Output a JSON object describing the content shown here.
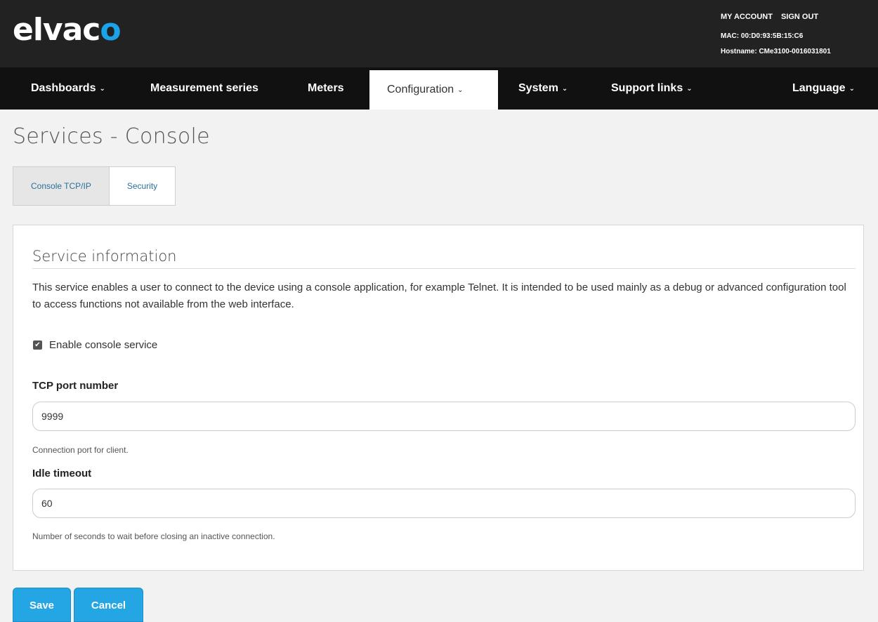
{
  "header": {
    "logo_main": "elvac",
    "logo_accent": "o",
    "my_account": "MY ACCOUNT",
    "sign_out": "SIGN OUT",
    "mac": "MAC: 00:D0:93:5B:15:C6",
    "hostname": "Hostname: CMe3100-0016031801"
  },
  "nav": {
    "items": [
      {
        "label": "Dashboards",
        "caret": "⌄"
      },
      {
        "label": "Measurement series"
      },
      {
        "label": "Meters"
      },
      {
        "label": "Configuration",
        "caret": "⌄",
        "active": true
      },
      {
        "label": "System",
        "caret": "⌄"
      },
      {
        "label": "Support links",
        "caret": "⌄"
      },
      {
        "label": "Language",
        "caret": "⌄"
      }
    ]
  },
  "page": {
    "title": "Services - Console"
  },
  "tabs": [
    {
      "label": "Console TCP/IP",
      "active": true
    },
    {
      "label": "Security"
    }
  ],
  "panel": {
    "section_title": "Service information",
    "description": "This service enables a user to connect to the device using a console application, for example Telnet. It is intended to be used mainly as a debug or advanced configuration tool to access functions not available from the web interface.",
    "enable_label": "Enable console service",
    "enable_checked": true,
    "tcp_port": {
      "label": "TCP port number",
      "value": "9999",
      "help": "Connection port for client."
    },
    "idle_timeout": {
      "label": "Idle timeout",
      "value": "60",
      "help": "Number of seconds to wait before closing an inactive connection."
    }
  },
  "actions": {
    "save_label": "Save",
    "cancel_label": "Cancel"
  },
  "colors": {
    "accent": "#24a5e4",
    "logo_accent": "#1aa3e8",
    "header_bg": "#222222",
    "nav_bg": "#111111"
  }
}
